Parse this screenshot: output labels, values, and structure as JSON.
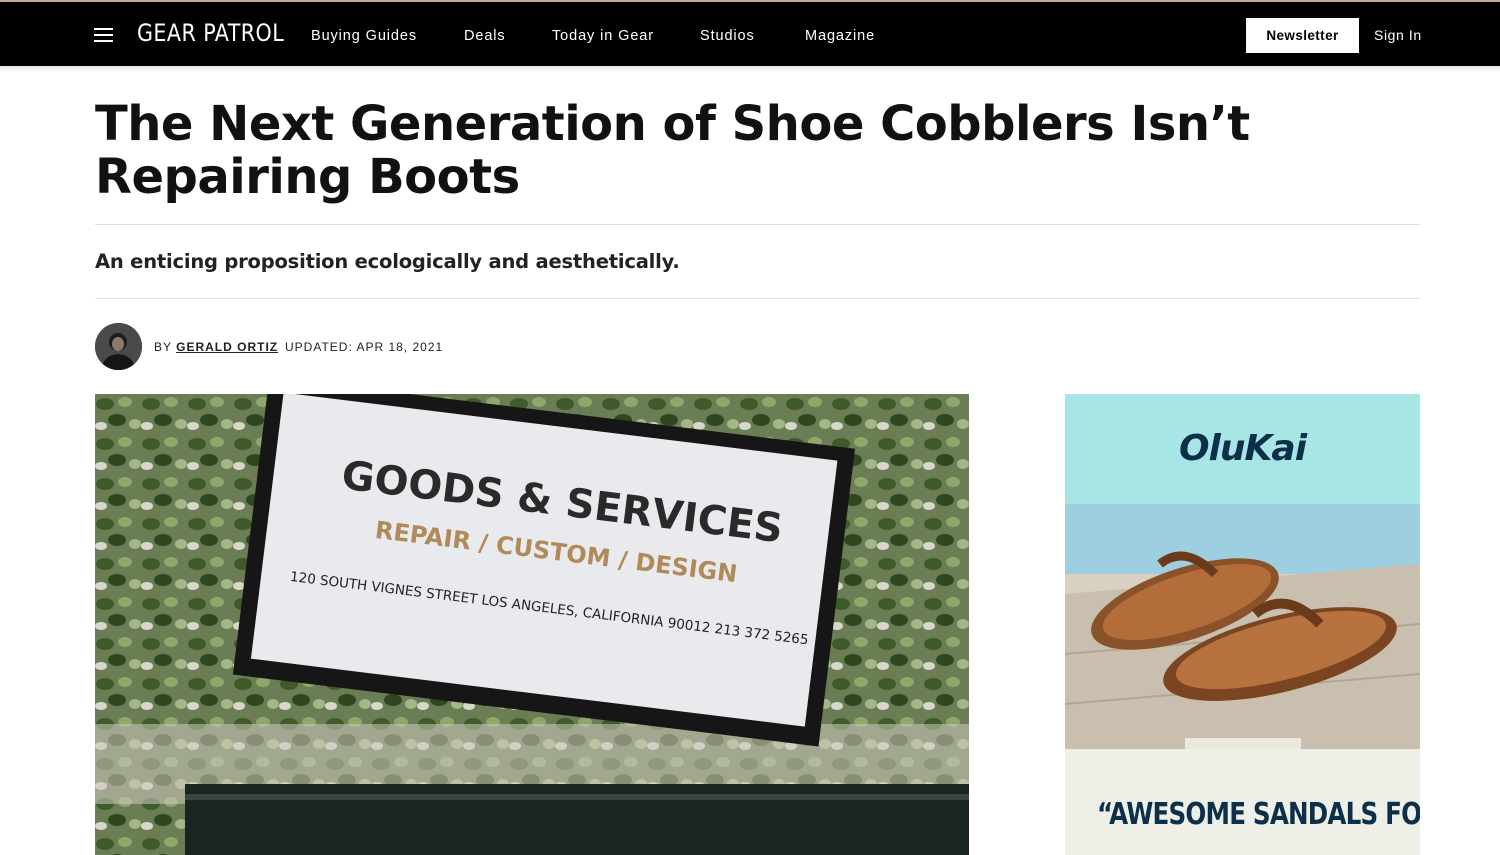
{
  "header": {
    "logo": "GEAR PATROL",
    "nav": [
      "Buying Guides",
      "Deals",
      "Today in Gear",
      "Studios",
      "Magazine"
    ],
    "newsletter_label": "Newsletter",
    "signin_label": "Sign In"
  },
  "article": {
    "title": "The Next Generation of Shoe Cobblers Isn’t Repairing Boots",
    "dek": "An enticing proposition ecologically and aesthetically.",
    "byline_prefix": "BY",
    "author": "GERALD ORTIZ",
    "updated": "UPDATED: APR 18, 2021",
    "hero_sign": {
      "line1": "GOODS & SERVICES",
      "line2": "REPAIR / CUSTOM / DESIGN",
      "line3": "120 SOUTH VIGNES STREET LOS ANGELES, CALIFORNIA 90012  213 372 5265"
    }
  },
  "ad": {
    "brand": "OluKai",
    "quote": "“AWESOME SANDALS FOR ANY SITUATION"
  },
  "colors": {
    "header_bg": "#000000",
    "accent_line": "#c8a98a",
    "ad_top": "#a8e6e6",
    "ad_text": "#0e2f4a"
  }
}
